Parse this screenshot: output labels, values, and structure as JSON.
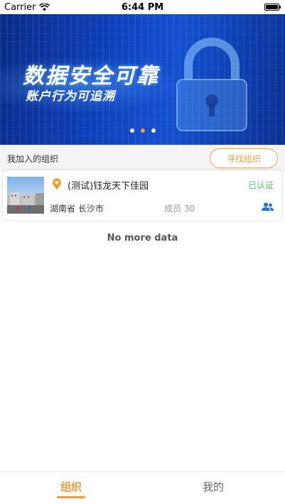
{
  "status_bar": {
    "carrier": "Carrier",
    "time": "6:44 PM"
  },
  "banner": {
    "title": "数据安全可靠",
    "subtitle": "账户行为可追溯",
    "slide_count": 3,
    "active_slide": 2,
    "colors": {
      "active_dot": "#f19a3e",
      "inactive_dot": "#ffffff"
    }
  },
  "section": {
    "label": "我加入的组织",
    "find_button": "寻找组织"
  },
  "organization": {
    "name": "(测试)钰龙天下佳园",
    "status": "已认证",
    "location": "湖南省 长沙市",
    "members": "成员 30",
    "icons": {
      "location": "location-pin-icon",
      "members": "members-icon",
      "photo": "organization-photo"
    }
  },
  "list": {
    "end_text": "No more data"
  },
  "tab_bar": {
    "tabs": [
      {
        "label": "组织",
        "active": true
      },
      {
        "label": "我的",
        "active": false
      }
    ]
  },
  "colors": {
    "accent": "#f19a3e",
    "verified": "#4cc36a",
    "member_icon": "#2c6fc4"
  }
}
